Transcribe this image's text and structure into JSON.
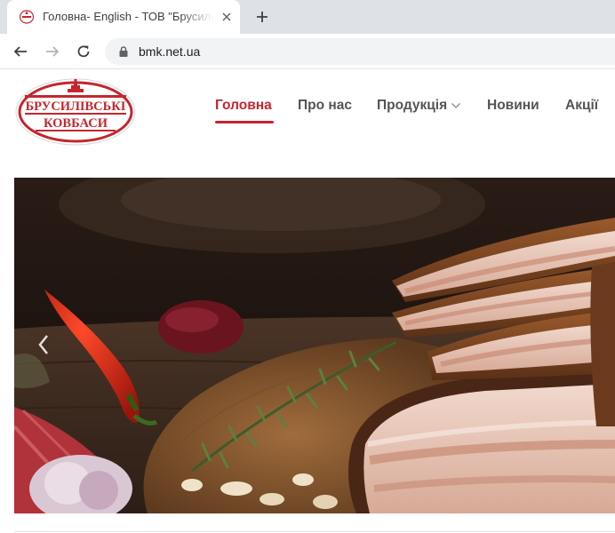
{
  "browser": {
    "tab_title": "Головна- English - ТОВ \"Брусилівські ковбаси\"",
    "url": "bmk.net.ua",
    "colors": {
      "tabstrip": "#dee1e6",
      "omnibox": "#f1f3f4"
    }
  },
  "logo": {
    "line1": "БРУСИЛІВСЬКІ",
    "line2": "КОВБАСИ",
    "brand_color": "#c4262e"
  },
  "nav": {
    "items": [
      {
        "label": "Головна",
        "active": true
      },
      {
        "label": "Про нас",
        "active": false
      },
      {
        "label": "Продукція",
        "active": false,
        "has_dropdown": true
      },
      {
        "label": "Новини",
        "active": false
      },
      {
        "label": "Акції",
        "active": false
      }
    ],
    "active_color": "#c4262e",
    "text_color": "#555555"
  },
  "hero": {
    "icons": {
      "prev": "chevron-left-icon"
    }
  }
}
